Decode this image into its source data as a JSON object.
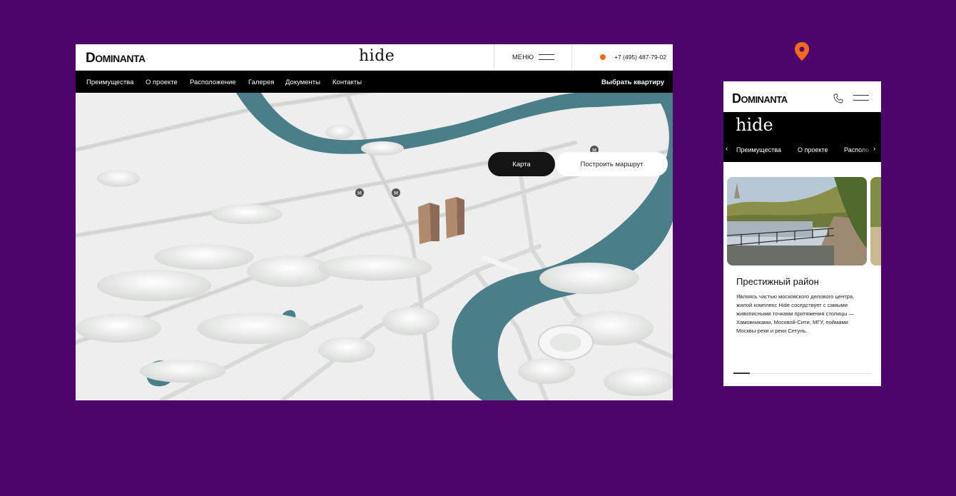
{
  "colors": {
    "background": "#4e0569",
    "accent": "#f26a21",
    "river": "#4a7f89",
    "nav_bg": "#000000"
  },
  "desktop": {
    "logo": {
      "first": "D",
      "rest": "OMINANTA"
    },
    "brand": "hide",
    "menu_label": "МЕНЮ",
    "phone": "+7 (495) 487-79-02",
    "nav": [
      "Преимущества",
      "О проекте",
      "Расположение",
      "Галерея",
      "Документы",
      "Контакты"
    ],
    "cta": "Выбрать квартиру",
    "map_buttons": {
      "map": "Карта",
      "route": "Построить маршрут"
    }
  },
  "mobile": {
    "logo": {
      "first": "D",
      "rest": "OMINANTA"
    },
    "brand": "hide",
    "nav": [
      "Преимущества",
      "О проекте",
      "Располо"
    ],
    "card": {
      "title": "Престижный район",
      "text": "Являясь частью московского делового центра, жилой комплекс Hide соседствует с самыми живописными точками притяжения столицы — Хамовниками, Москвой-Сити, МГУ, поймами Москвы-реки и реки Сетунь."
    },
    "progress": 0.12
  }
}
